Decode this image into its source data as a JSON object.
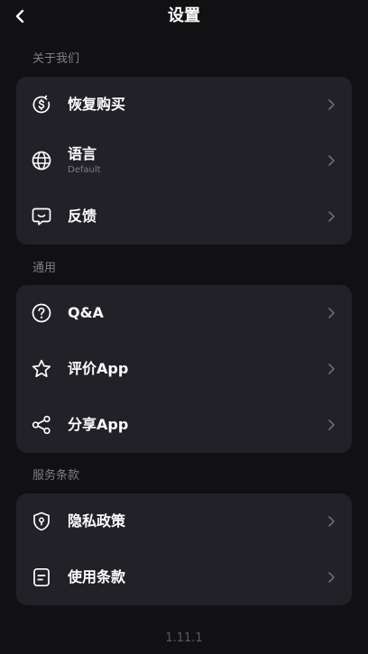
{
  "header": {
    "title": "设置"
  },
  "sections": [
    {
      "label": "关于我们",
      "items": [
        {
          "label": "恢复购买",
          "icon": "restore-purchase-icon"
        },
        {
          "label": "语言",
          "sublabel": "Default",
          "icon": "globe-icon"
        },
        {
          "label": "反馈",
          "icon": "feedback-chat-icon"
        }
      ]
    },
    {
      "label": "通用",
      "items": [
        {
          "label": "Q&A",
          "icon": "question-circle-icon"
        },
        {
          "label": "评价App",
          "icon": "star-icon"
        },
        {
          "label": "分享App",
          "icon": "share-icon"
        }
      ]
    },
    {
      "label": "服务条款",
      "items": [
        {
          "label": "隐私政策",
          "icon": "shield-lock-icon"
        },
        {
          "label": "使用条款",
          "icon": "document-icon"
        }
      ]
    }
  ],
  "footer": {
    "version": "1.11.1"
  },
  "colors": {
    "background": "#111114",
    "card": "#212127",
    "muted_text": "#7f7f86",
    "chevron": "#6b6b72"
  }
}
